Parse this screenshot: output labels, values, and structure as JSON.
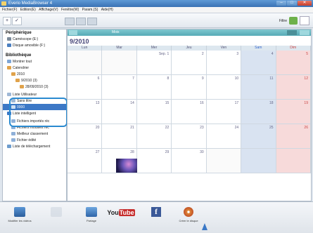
{
  "window": {
    "title": "Everio MediaBrowser 4",
    "controls": [
      "–",
      "□",
      "✕"
    ]
  },
  "menu": [
    "Fichier(F)",
    "Edition(E)",
    "Affichage(V)",
    "Fenêtre(W)",
    "Param.(S)",
    "Aide(H)"
  ],
  "toolbar": {
    "add": "+",
    "edit": "✓",
    "filter_label": "Filtre"
  },
  "sidebar": {
    "peripherique_title": "Périphérique",
    "devices": [
      "Caméscope (E:)",
      "Disque amovible (F:)"
    ],
    "bibliotheque_title": "Bibliothèque",
    "library": [
      {
        "label": "Montrer tout",
        "indent": 1
      },
      {
        "label": "Calendrier",
        "indent": 1
      },
      {
        "label": "2010",
        "indent": 2
      },
      {
        "label": "9/2010 (3)",
        "indent": 3
      },
      {
        "label": "28/09/2010 (3)",
        "indent": 4
      },
      {
        "label": "Liste Utilisateur",
        "indent": 1
      },
      {
        "label": "Sans titre",
        "indent": 2
      },
      {
        "label": "0000",
        "indent": 2,
        "selected": true
      },
      {
        "label": "Liste intelligent",
        "indent": 1
      },
      {
        "label": "Fichiers importés réc",
        "indent": 2
      },
      {
        "label": "Fichiers modifiés réc",
        "indent": 2
      },
      {
        "label": "Meilleur classement",
        "indent": 2
      },
      {
        "label": "Fichier édité",
        "indent": 2
      },
      {
        "label": "Liste de téléchargement",
        "indent": 1
      }
    ]
  },
  "calendar": {
    "view_label": "Mois",
    "month": "9/2010",
    "weekdays": [
      "Lun",
      "Mar",
      "Mer",
      "Jeu",
      "Ven",
      "Sam",
      "Dim"
    ],
    "weeks": [
      [
        "",
        "",
        "Sep. 1",
        "2",
        "3",
        "4",
        "5"
      ],
      [
        "6",
        "7",
        "8",
        "9",
        "10",
        "11",
        "12"
      ],
      [
        "13",
        "14",
        "15",
        "16",
        "17",
        "18",
        "19"
      ],
      [
        "20",
        "21",
        "22",
        "23",
        "24",
        "25",
        "26"
      ],
      [
        "27",
        "28",
        "29",
        "30",
        "",
        "",
        ""
      ]
    ]
  },
  "bottom": {
    "buttons": [
      {
        "label": "Modifier les vidéos",
        "icon": "film-edit-icon"
      },
      {
        "label": "",
        "icon": "disc-disabled-icon"
      },
      {
        "label": "Partage",
        "icon": "share-icon"
      },
      {
        "label": "",
        "icon": "youtube-icon",
        "text": "You Tube"
      },
      {
        "label": "",
        "icon": "facebook-icon",
        "text": "f"
      },
      {
        "label": "Créer le disque",
        "icon": "create-disc-icon"
      }
    ]
  },
  "colors": {
    "accent": "#3c78c6",
    "calendar_header": "#56aab6",
    "saturday": "#d9e3f1",
    "sunday": "#f7dada"
  }
}
